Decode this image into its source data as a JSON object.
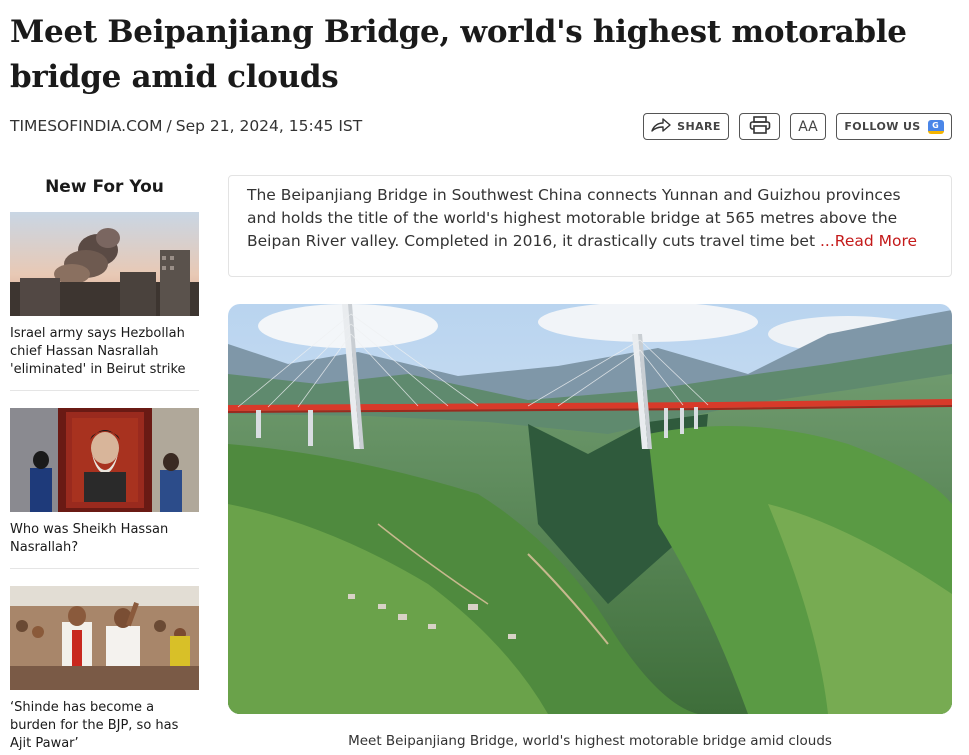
{
  "article": {
    "headline": "Meet Beipanjiang Bridge, world's highest motorable bridge amid clouds",
    "source": "TIMESOFINDIA.COM",
    "separator": "/",
    "date": "Sep 21, 2024, 15:45 IST"
  },
  "actions": {
    "share_label": "SHARE",
    "aa_label": "AA",
    "follow_label": "FOLLOW US",
    "google_badge": "G"
  },
  "sidebar": {
    "title": "New For You",
    "stories": [
      {
        "text": "Israel army says Hezbollah chief Hassan Nasrallah 'eliminated' in Beirut strike"
      },
      {
        "text": "Who was Sheikh Hassan Nasrallah?"
      },
      {
        "text": "‘Shinde has become a burden for the BJP, so has Ajit Pawar’"
      }
    ]
  },
  "summary": {
    "text": "The Beipanjiang Bridge in Southwest China connects Yunnan and Guizhou provinces and holds the title of the world's highest motorable bridge at 565 metres above the Beipan River valley. Completed in 2016, it drastically cuts travel time bet ",
    "read_more": "...Read More"
  },
  "hero": {
    "caption": "Meet Beipanjiang Bridge, world's highest motorable bridge amid clouds"
  },
  "colors": {
    "accent_red": "#c41a1a",
    "bridge_red": "#d83a2a"
  }
}
